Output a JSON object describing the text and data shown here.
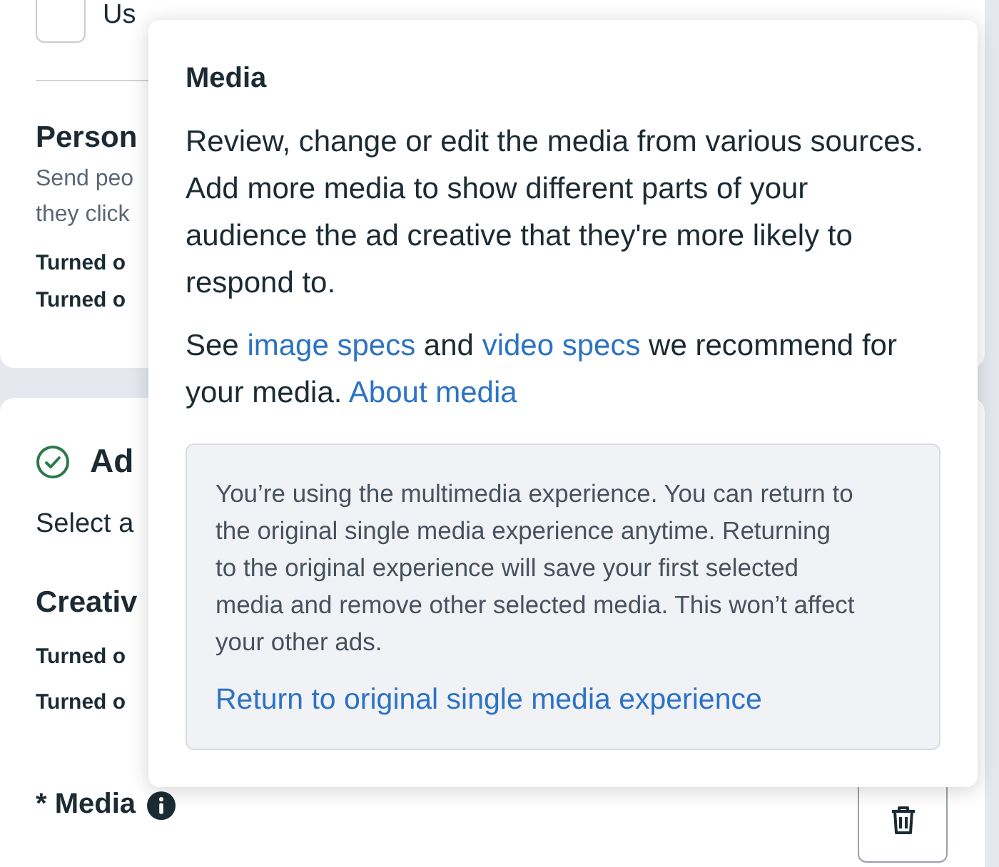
{
  "background": {
    "checkbox": {
      "label": "Us",
      "checked": false
    },
    "personalization": {
      "title": "Person",
      "description": [
        "Send peo",
        "they click"
      ],
      "rows": [
        "Turned o",
        "Turned o"
      ]
    },
    "ad_section": {
      "done": true,
      "title": "Ad",
      "description": "Select a",
      "subtitle": "Creativ",
      "rows": [
        "Turned o",
        "Turned o"
      ]
    },
    "media_label": "* Media"
  },
  "popover": {
    "title": "Media",
    "body": "Review, change or edit the media from various sources. Add more media to show different parts of your audience the ad creative that they're more likely to respond to.",
    "links_paragraph": [
      {
        "kind": "text",
        "text": "See "
      },
      {
        "kind": "link",
        "text": "image specs"
      },
      {
        "kind": "text",
        "text": " and "
      },
      {
        "kind": "link",
        "text": "video specs"
      },
      {
        "kind": "text",
        "text": " we recommend for your media. "
      },
      {
        "kind": "link",
        "text": "About media"
      }
    ],
    "notice": {
      "text": "You’re using the multimedia experience. You can return to the original single media experience anytime. Returning to the original experience will save your first selected media and remove other selected media. This won’t affect your other ads.",
      "link": "Return to original single media experience"
    }
  }
}
